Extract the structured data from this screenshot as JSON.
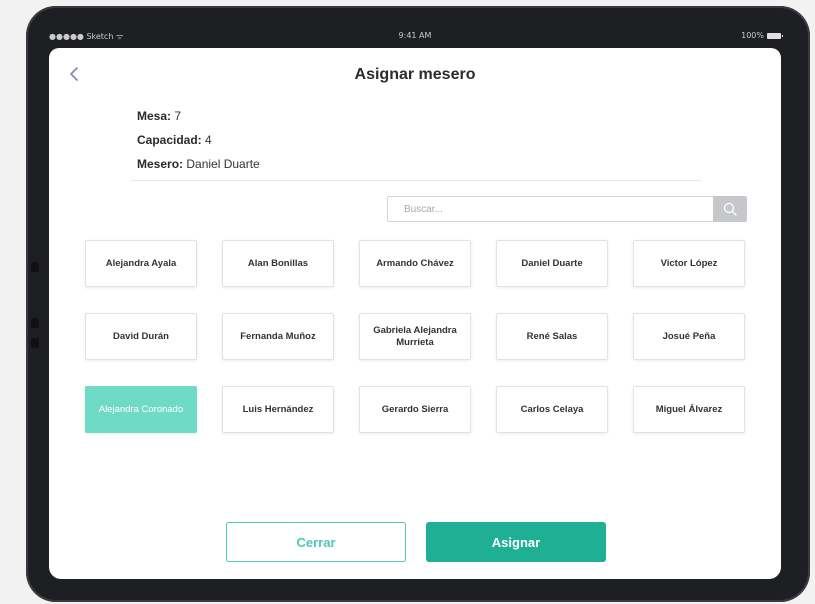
{
  "status_bar": {
    "carrier": "●●●●● Sketch ᯤ",
    "time": "9:41 AM",
    "battery": "100%"
  },
  "header": {
    "title": "Asignar mesero",
    "back_icon": "chevron-left-icon"
  },
  "info": {
    "mesa_label": "Mesa:",
    "mesa_value": " 7",
    "capacidad_label": "Capacidad:",
    "capacidad_value": " 4",
    "mesero_label": "Mesero:",
    "mesero_value": " Daniel Duarte"
  },
  "search": {
    "placeholder": "Buscar...",
    "value": "",
    "icon": "search-icon"
  },
  "waiters": [
    "Alejandra Ayala",
    "Alan Bonillas",
    "Armando Chávez",
    "Daniel Duarte",
    "Victor López",
    "David Durán",
    "Fernanda Muñoz",
    "Gabriela Alejandra Murrieta",
    "René Salas",
    "Josué Peña",
    "Alejandra Coronado",
    "Luis Hernández",
    "Gerardo Sierra",
    "Carlos Celaya",
    "Miguel Álvarez"
  ],
  "selected_waiter": "Alejandra Coronado",
  "actions": {
    "close_label": "Cerrar",
    "assign_label": "Asignar"
  },
  "colors": {
    "accent": "#1faf95",
    "selected": "#6fdbc6",
    "outline": "#4cc9b4"
  }
}
